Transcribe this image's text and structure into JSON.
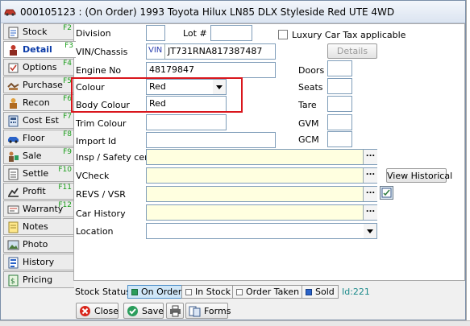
{
  "window": {
    "title": "000105123 : (On Order) 1993 Toyota Hilux LN85 DLX Styleside Red UTE 4WD"
  },
  "tabs": [
    {
      "label": "Stock",
      "key": "F2",
      "icon": "stock-icon"
    },
    {
      "label": "Detail",
      "key": "F3",
      "icon": "detail-icon",
      "active": true
    },
    {
      "label": "Options",
      "key": "F4",
      "icon": "options-icon"
    },
    {
      "label": "Purchase",
      "key": "F5",
      "icon": "purchase-icon"
    },
    {
      "label": "Recon",
      "key": "F6",
      "icon": "recon-icon"
    },
    {
      "label": "Cost Est",
      "key": "F7",
      "icon": "cost-est-icon"
    },
    {
      "label": "Floor",
      "key": "F8",
      "icon": "floor-icon"
    },
    {
      "label": "Sale",
      "key": "F9",
      "icon": "sale-icon"
    },
    {
      "label": "Settle",
      "key": "F10",
      "icon": "settle-icon"
    },
    {
      "label": "Profit",
      "key": "F11",
      "icon": "profit-icon"
    },
    {
      "label": "Warranty",
      "key": "F12",
      "icon": "warranty-icon"
    },
    {
      "label": "Notes",
      "key": "",
      "icon": "notes-icon"
    },
    {
      "label": "Photo",
      "key": "",
      "icon": "photo-icon"
    },
    {
      "label": "History",
      "key": "",
      "icon": "history-icon"
    },
    {
      "label": "Pricing",
      "key": "",
      "icon": "pricing-icon"
    }
  ],
  "form": {
    "division_label": "Division",
    "division_value": "",
    "lot_label": "Lot #",
    "lot_value": "",
    "luxury_tax_label": "Luxury Car Tax applicable",
    "luxury_tax_checked": false,
    "vin_label": "VIN/Chassis",
    "vin_badge": "VIN",
    "vin_value": "JT731RNA817387487",
    "details_button": "Details",
    "engine_label": "Engine No",
    "engine_value": "48179847",
    "doors_label": "Doors",
    "doors_value": "",
    "colour_label": "Colour",
    "colour_value": "Red",
    "seats_label": "Seats",
    "seats_value": "",
    "body_colour_label": "Body Colour",
    "body_colour_value": "Red",
    "tare_label": "Tare",
    "tare_value": "",
    "trim_label": "Trim Colour",
    "trim_value": "",
    "gvm_label": "GVM",
    "gvm_value": "",
    "import_label": "Import Id",
    "import_value": "",
    "gcm_label": "GCM",
    "gcm_value": "",
    "insp_label": "Insp / Safety cert",
    "insp_value": "",
    "vcheck_label": "VCheck",
    "vcheck_value": "",
    "view_historical_button": "View Historical",
    "revs_label": "REVS / VSR",
    "revs_value": "",
    "car_history_label": "Car History",
    "car_history_value": "",
    "location_label": "Location",
    "location_value": ""
  },
  "dots_label": "...",
  "stock_status": {
    "label": "Stock Status",
    "options": [
      "On Order",
      "In Stock",
      "Order Taken",
      "Sold"
    ],
    "selected": "On Order",
    "id_text": "Id:221"
  },
  "buttons": {
    "close": "Close",
    "save": "Save",
    "forms": "Forms"
  },
  "colors": {
    "accent_blue": "#0b3ba8",
    "highlight_red": "#d9161c",
    "fkey_green": "#1a9e1a",
    "yellow_field": "#ffffe0"
  }
}
